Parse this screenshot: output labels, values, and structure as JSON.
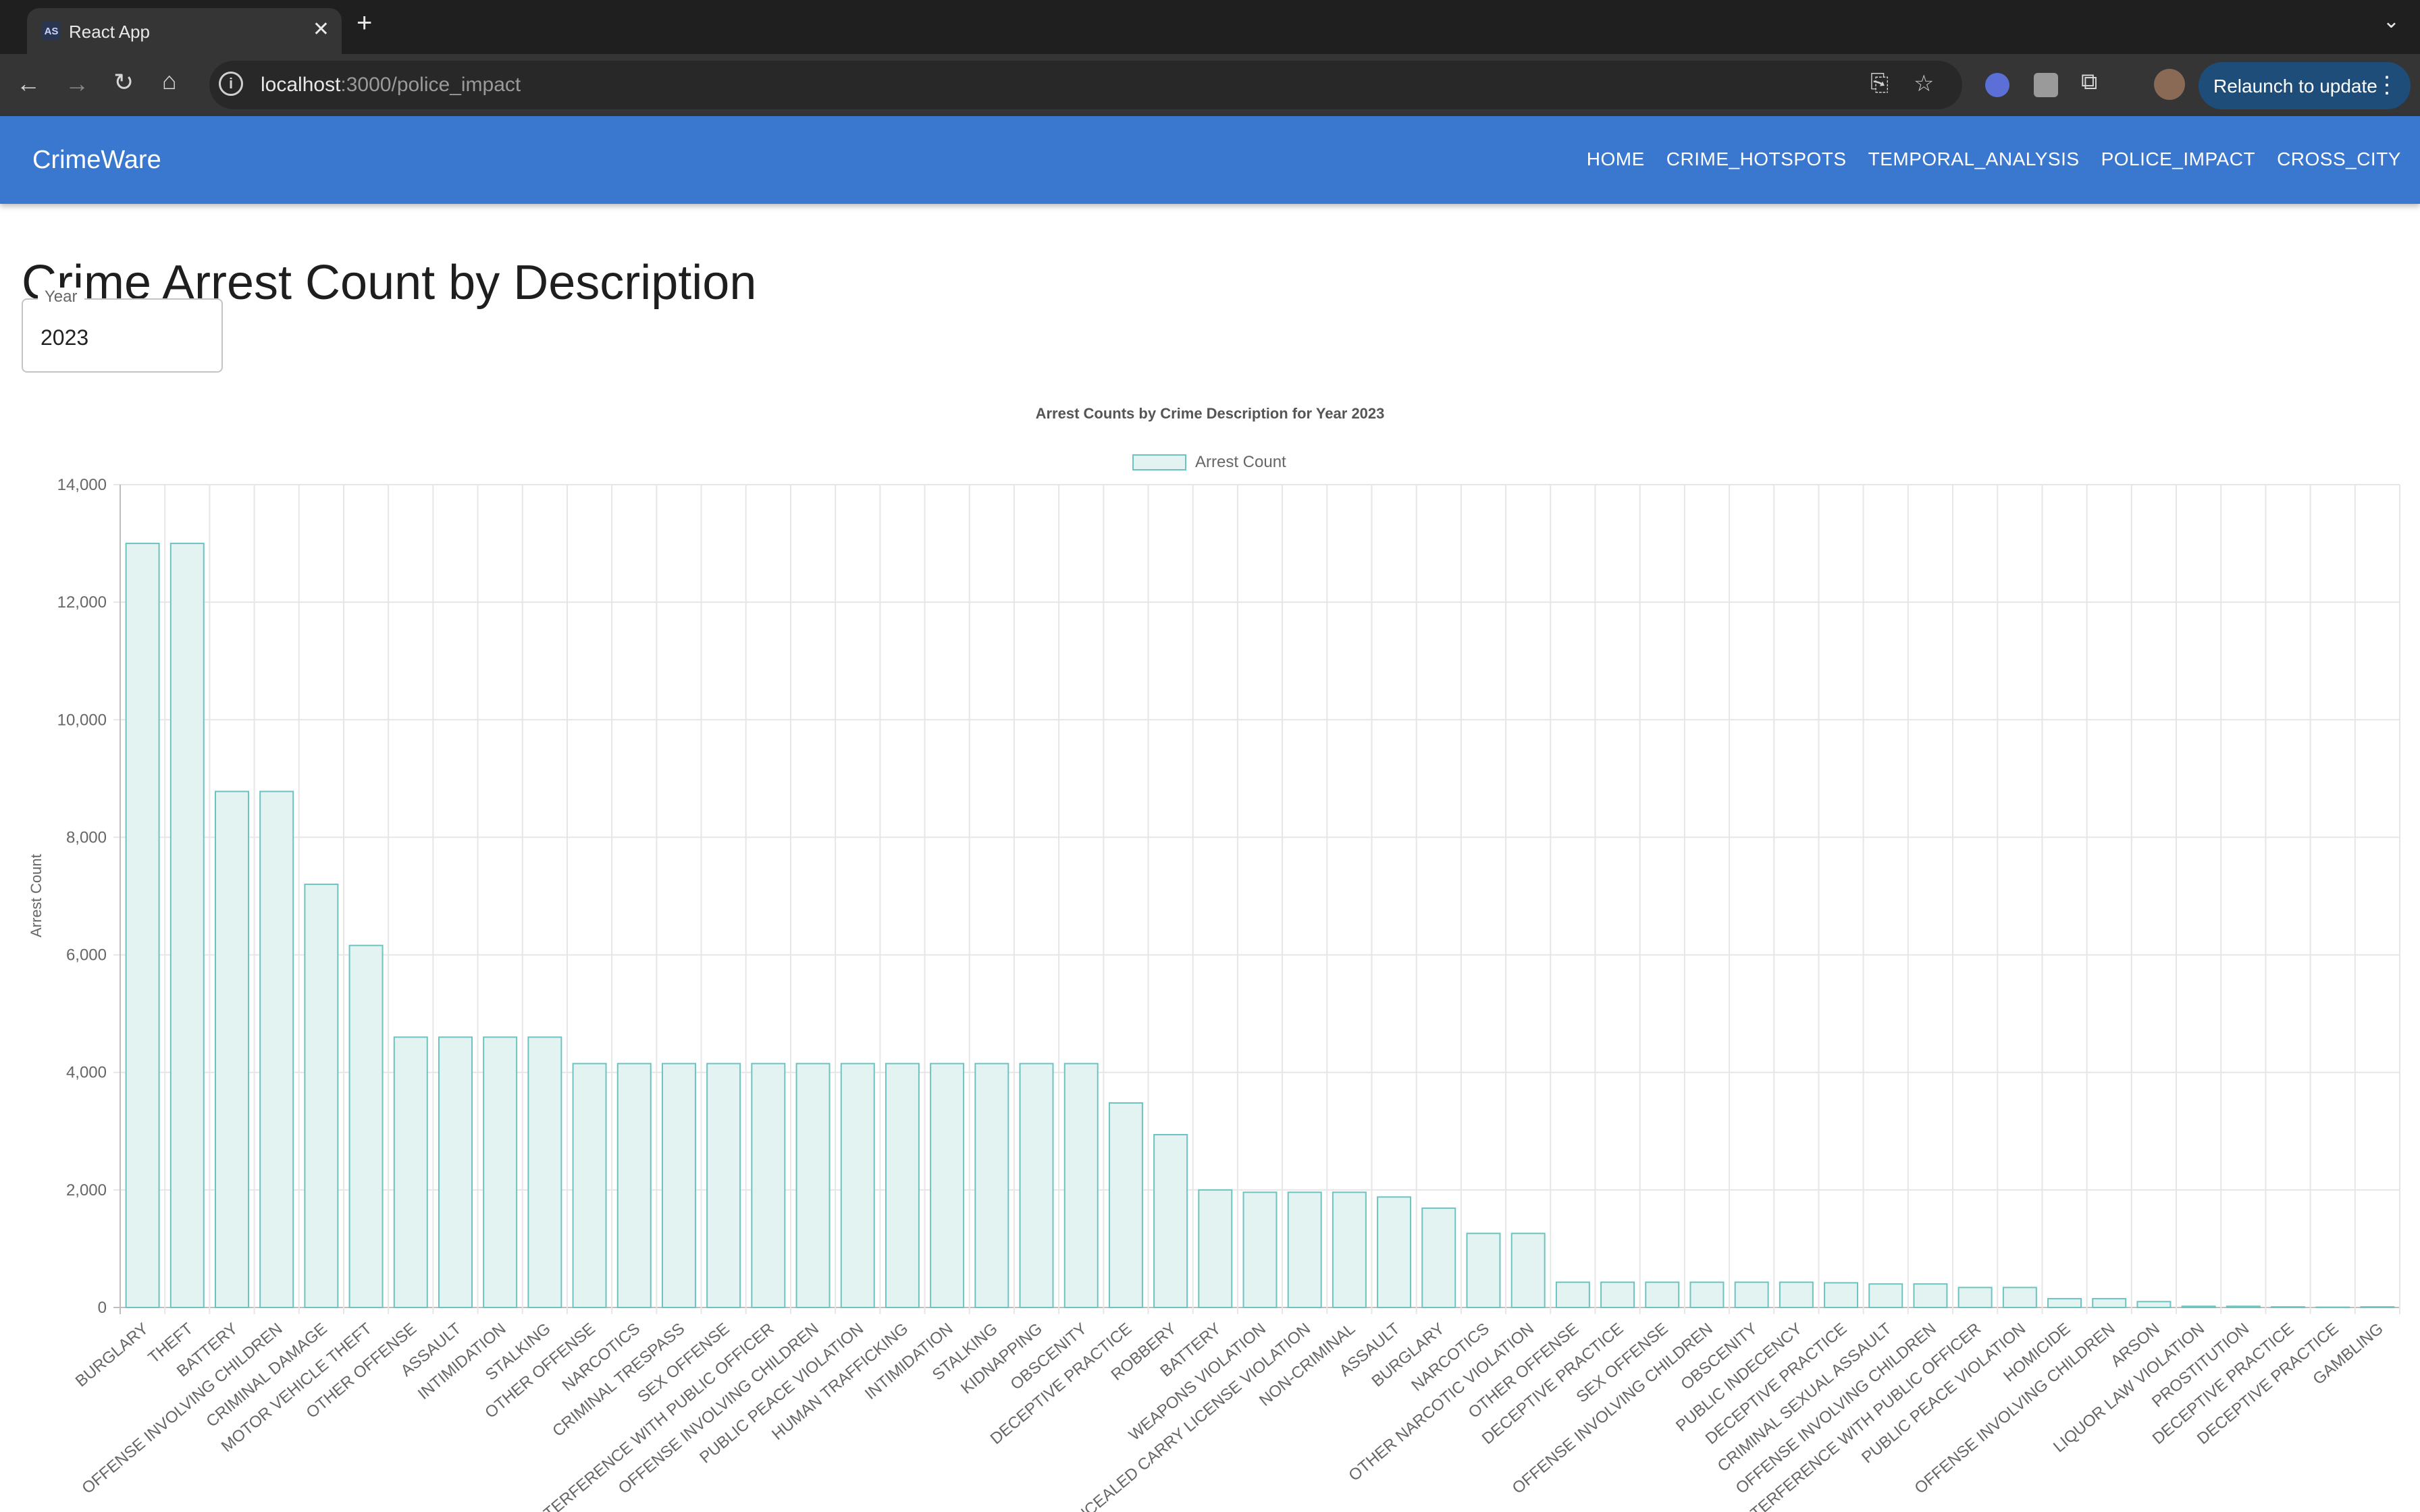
{
  "browser": {
    "tab_title": "React App",
    "tab_favicon_text": "AS",
    "url_host": "localhost",
    "url_path": ":3000/police_impact",
    "relaunch_label": "Relaunch to update"
  },
  "appbar": {
    "brand": "CrimeWare",
    "nav": [
      "HOME",
      "CRIME_HOTSPOTS",
      "TEMPORAL_ANALYSIS",
      "POLICE_IMPACT",
      "CROSS_CITY"
    ]
  },
  "page": {
    "title": "Crime Arrest Count by Description",
    "year_label": "Year",
    "year_value": "2023"
  },
  "colors": {
    "appbar": "#3a77cf",
    "bar_fill": "#e3f3f2",
    "bar_stroke": "#6cc3c0"
  },
  "chart_data": {
    "type": "bar",
    "title": "Arrest Counts by Crime Description for Year 2023",
    "ylabel": "Arrest Count",
    "xlabel": "",
    "legend": "Arrest Count",
    "legend_position": "top",
    "grid": true,
    "ylim": [
      0,
      14000
    ],
    "yticks": [
      "0",
      "2,000",
      "4,000",
      "6,000",
      "8,000",
      "10,000",
      "12,000",
      "14,000"
    ],
    "categories": [
      "BURGLARY",
      "THEFT",
      "BATTERY",
      "OFFENSE INVOLVING CHILDREN",
      "CRIMINAL DAMAGE",
      "MOTOR VEHICLE THEFT",
      "OTHER OFFENSE",
      "ASSAULT",
      "INTIMIDATION",
      "STALKING",
      "OTHER OFFENSE",
      "NARCOTICS",
      "CRIMINAL TRESPASS",
      "SEX OFFENSE",
      "INTERFERENCE WITH PUBLIC OFFICER",
      "OFFENSE INVOLVING CHILDREN",
      "PUBLIC PEACE VIOLATION",
      "HUMAN TRAFFICKING",
      "INTIMIDATION",
      "STALKING",
      "KIDNAPPING",
      "OBSCENITY",
      "DECEPTIVE PRACTICE",
      "ROBBERY",
      "BATTERY",
      "WEAPONS VIOLATION",
      "CONCEALED CARRY LICENSE VIOLATION",
      "NON-CRIMINAL",
      "ASSAULT",
      "BURGLARY",
      "NARCOTICS",
      "OTHER NARCOTIC VIOLATION",
      "OTHER OFFENSE",
      "DECEPTIVE PRACTICE",
      "SEX OFFENSE",
      "OFFENSE INVOLVING CHILDREN",
      "OBSCENITY",
      "PUBLIC INDECENCY",
      "DECEPTIVE PRACTICE",
      "CRIMINAL SEXUAL ASSAULT",
      "OFFENSE INVOLVING CHILDREN",
      "INTERFERENCE WITH PUBLIC OFFICER",
      "PUBLIC PEACE VIOLATION",
      "HOMICIDE",
      "OFFENSE INVOLVING CHILDREN",
      "ARSON",
      "LIQUOR LAW VIOLATION",
      "PROSTITUTION",
      "DECEPTIVE PRACTICE",
      "DECEPTIVE PRACTICE",
      "GAMBLING"
    ],
    "series": [
      {
        "name": "Arrest Count",
        "values": [
          13000,
          13000,
          8780,
          8780,
          7200,
          6160,
          4600,
          4600,
          4600,
          4600,
          4150,
          4150,
          4150,
          4150,
          4150,
          4150,
          4150,
          4150,
          4150,
          4150,
          4150,
          4150,
          3480,
          2940,
          2000,
          1960,
          1960,
          1960,
          1880,
          1690,
          1260,
          1260,
          430,
          430,
          430,
          430,
          430,
          430,
          420,
          400,
          400,
          340,
          340,
          150,
          150,
          100,
          20,
          20,
          10,
          5,
          10
        ]
      }
    ]
  }
}
